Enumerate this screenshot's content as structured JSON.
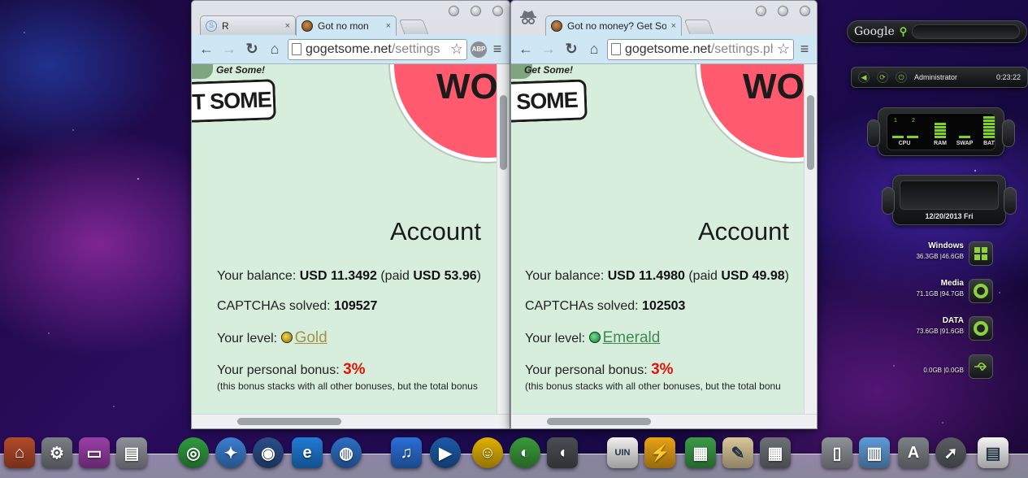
{
  "left_window": {
    "tabs": [
      {
        "title": "R",
        "close": "×",
        "icon": "r-extension-icon"
      },
      {
        "title": "Got no mon",
        "close": "×",
        "icon": "cookie-favicon-icon",
        "active": true
      }
    ],
    "url_domain": "gogetsome.net",
    "url_path": "/settings",
    "logo_tagline": "Get Some!",
    "logo_text": "T SOME",
    "promo_text": "WO",
    "page_title": "Account",
    "balance_label": "Your balance: ",
    "balance_value": "USD 11.3492",
    "paid_prefix": " (paid ",
    "paid_value": "USD 53.96",
    "paid_suffix": ")",
    "captchas_label": "CAPTCHAs solved: ",
    "captchas_value": "109527",
    "level_label": "Your level: ",
    "level_value": "Gold",
    "bonus_label": "Your personal bonus: ",
    "bonus_value": "3%",
    "bonus_note": "(this bonus stacks with all other bonuses, but the total bonus"
  },
  "right_window": {
    "tabs": [
      {
        "title": "Got no money? Get Some!",
        "close": "×",
        "icon": "cookie-favicon-icon",
        "active": true
      }
    ],
    "url_domain": "gogetsome.net",
    "url_path": "/settings.ph",
    "logo_tagline": "Get Some!",
    "logo_text": "SOME",
    "promo_text": "WO",
    "page_title": "Account",
    "balance_label": "Your balance: ",
    "balance_value": "USD 11.4980",
    "paid_prefix": " (paid ",
    "paid_value": "USD 49.98",
    "paid_suffix": ")",
    "captchas_label": "CAPTCHAs solved: ",
    "captchas_value": "102503",
    "level_label": "Your level: ",
    "level_value": "Emerald",
    "bonus_label": "Your personal bonus: ",
    "bonus_value": "3%",
    "bonus_note": "(this bonus stacks with all other bonuses, but the total bonu"
  },
  "toolbar_icons": {
    "back": "←",
    "forward": "→",
    "reload": "↻",
    "home": "⌂",
    "star": "☆",
    "abp": "ABP",
    "menu": "≡"
  },
  "gadgets": {
    "search_brand": "Google",
    "search_icon": "⚲",
    "user_name": "Administrator",
    "user_time": "0:23:22",
    "meter_labels": [
      "CPU",
      "RAM",
      "SWAP",
      "BAT"
    ],
    "cpu_cores": [
      "1",
      "2"
    ],
    "clock_date": "12/20/2013 Fri",
    "drives": [
      {
        "name": "Windows",
        "size": "36.3GB  |46.6GB",
        "icon": "windows-logo-icon"
      },
      {
        "name": "Media",
        "size": "71.1GB  |94.7GB",
        "icon": "drive-ring-icon"
      },
      {
        "name": "DATA",
        "size": "73.6GB  |91.6GB",
        "icon": "drive-ring-icon"
      },
      {
        "name": "",
        "size": "0.0GB  |0.0GB",
        "icon": "usb-icon"
      }
    ]
  },
  "colors": {
    "page_bg": "#d8eedc",
    "bonus_red": "#e1140d",
    "gold": "#a39348",
    "emerald": "#3e8a55",
    "toolbar": "#cfe7f5",
    "gadget_green": "#8cd23c"
  },
  "dock": [
    {
      "name": "home-icon",
      "glyph": "⌂",
      "color": "#b34a2a"
    },
    {
      "name": "system-preferences-icon",
      "glyph": "⚙",
      "color": "#7a7f86"
    },
    {
      "name": "desktop-icon",
      "glyph": "▭",
      "color": "#9a3ea8"
    },
    {
      "name": "disk-utility-icon",
      "glyph": "▤",
      "color": "#8d9299"
    },
    {
      "name": "chrome-icon",
      "glyph": "◎",
      "color": "#2f9b3f"
    },
    {
      "name": "safari-icon",
      "glyph": "✦",
      "color": "#3b7fd0"
    },
    {
      "name": "orb-icon",
      "glyph": "◉",
      "color": "#2a4e8a"
    },
    {
      "name": "internet-explorer-icon",
      "glyph": "e",
      "color": "#1f7bd6"
    },
    {
      "name": "network-globe-icon",
      "glyph": "◍",
      "color": "#2d6fc4"
    },
    {
      "name": "itunes-icon",
      "glyph": "♫",
      "color": "#2b6fd6"
    },
    {
      "name": "media-player-icon",
      "glyph": "▶",
      "color": "#1c5aa8"
    },
    {
      "name": "yahoo-messenger-icon",
      "glyph": "☺",
      "color": "#e0b100"
    },
    {
      "name": "download-globe-icon",
      "glyph": "◐",
      "color": "#3a9a3a"
    },
    {
      "name": "speaker-icon",
      "glyph": "◖",
      "color": "#4a4d52"
    },
    {
      "name": "uin-icon",
      "glyph": "UIN",
      "color": "#f0f0f0"
    },
    {
      "name": "winamp-icon",
      "glyph": "⚡",
      "color": "#e8a316"
    },
    {
      "name": "spreadsheet-icon",
      "glyph": "▦",
      "color": "#3c9a48"
    },
    {
      "name": "text-editor-icon",
      "glyph": "✎",
      "color": "#d8c79a"
    },
    {
      "name": "calculator-icon",
      "glyph": "▦",
      "color": "#6d7177"
    },
    {
      "name": "trash-icon",
      "glyph": "▯",
      "color": "#8e9399"
    },
    {
      "name": "applications-folder-icon",
      "glyph": "▥",
      "color": "#5f9bd6"
    },
    {
      "name": "app-store-icon",
      "glyph": "A",
      "color": "#7d8288"
    },
    {
      "name": "launchpad-icon",
      "glyph": "➚",
      "color": "#5a5e64"
    },
    {
      "name": "document-icon",
      "glyph": "▤",
      "color": "#f4f4f4"
    }
  ]
}
